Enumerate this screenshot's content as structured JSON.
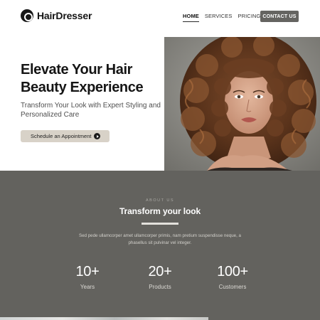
{
  "brand": {
    "name": "HairDresser",
    "logo_icon": "circle-logo-icon"
  },
  "nav": {
    "items": [
      {
        "label": "HOME",
        "active": true
      },
      {
        "label": "SERVICES",
        "active": false
      },
      {
        "label": "PRICING",
        "active": false
      }
    ],
    "contact_label": "CONTACT US"
  },
  "hero": {
    "title": "Elevate Your Hair Beauty Experience",
    "subtitle": "Transform Your Look with Expert Styling and Personalized Care",
    "cta_label": "Schedule an Appointment",
    "cta_icon": "arrow-right-circle-icon"
  },
  "about": {
    "eyebrow": "ABOUT US",
    "title": "Transform your look",
    "text": "Sed pede ullamcorper amet ullamcorper primis, nam pretium suspendisse neque, a phasellus sit pulvinar vel integer.",
    "stats": [
      {
        "value": "10+",
        "label": "Years"
      },
      {
        "value": "20+",
        "label": "Products"
      },
      {
        "value": "100+",
        "label": "Customers"
      }
    ]
  },
  "colors": {
    "accent_dark": "#63625e",
    "cta_background": "#d8d2c8",
    "contact_button": "#656461",
    "text_dark": "#151515"
  }
}
